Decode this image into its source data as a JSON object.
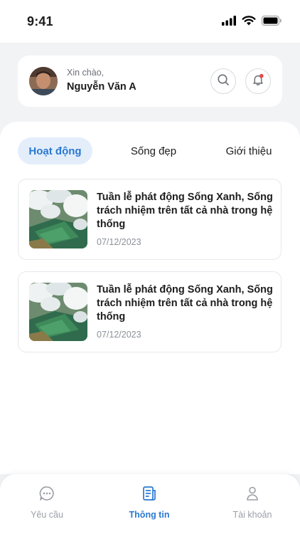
{
  "status_bar": {
    "time": "9:41"
  },
  "header": {
    "greeting": "Xin chào,",
    "user_name": "Nguyễn Văn A",
    "notification_dot_color": "#e5484d"
  },
  "tabs": [
    {
      "label": "Hoạt động",
      "active": true
    },
    {
      "label": "Sống đẹp",
      "active": false
    },
    {
      "label": "Giới thiệu",
      "active": false
    }
  ],
  "news": [
    {
      "title": "Tuần lễ phát động Sống Xanh, Sống trách nhiệm trên tất cả nhà trong hệ thống",
      "date": "07/12/2023"
    },
    {
      "title": "Tuần lễ phát động Sống Xanh, Sống trách nhiệm trên tất cả nhà trong hệ thống",
      "date": "07/12/2023"
    }
  ],
  "bottom_nav": [
    {
      "label": "Yêu cầu",
      "icon": "chat-bubble-icon",
      "active": false
    },
    {
      "label": "Thông tin",
      "icon": "document-icon",
      "active": true
    },
    {
      "label": "Tài khoản",
      "icon": "person-icon",
      "active": false
    }
  ],
  "colors": {
    "accent": "#2a79d1",
    "accent_bg": "#e4eefb",
    "background": "#f2f3f5"
  }
}
